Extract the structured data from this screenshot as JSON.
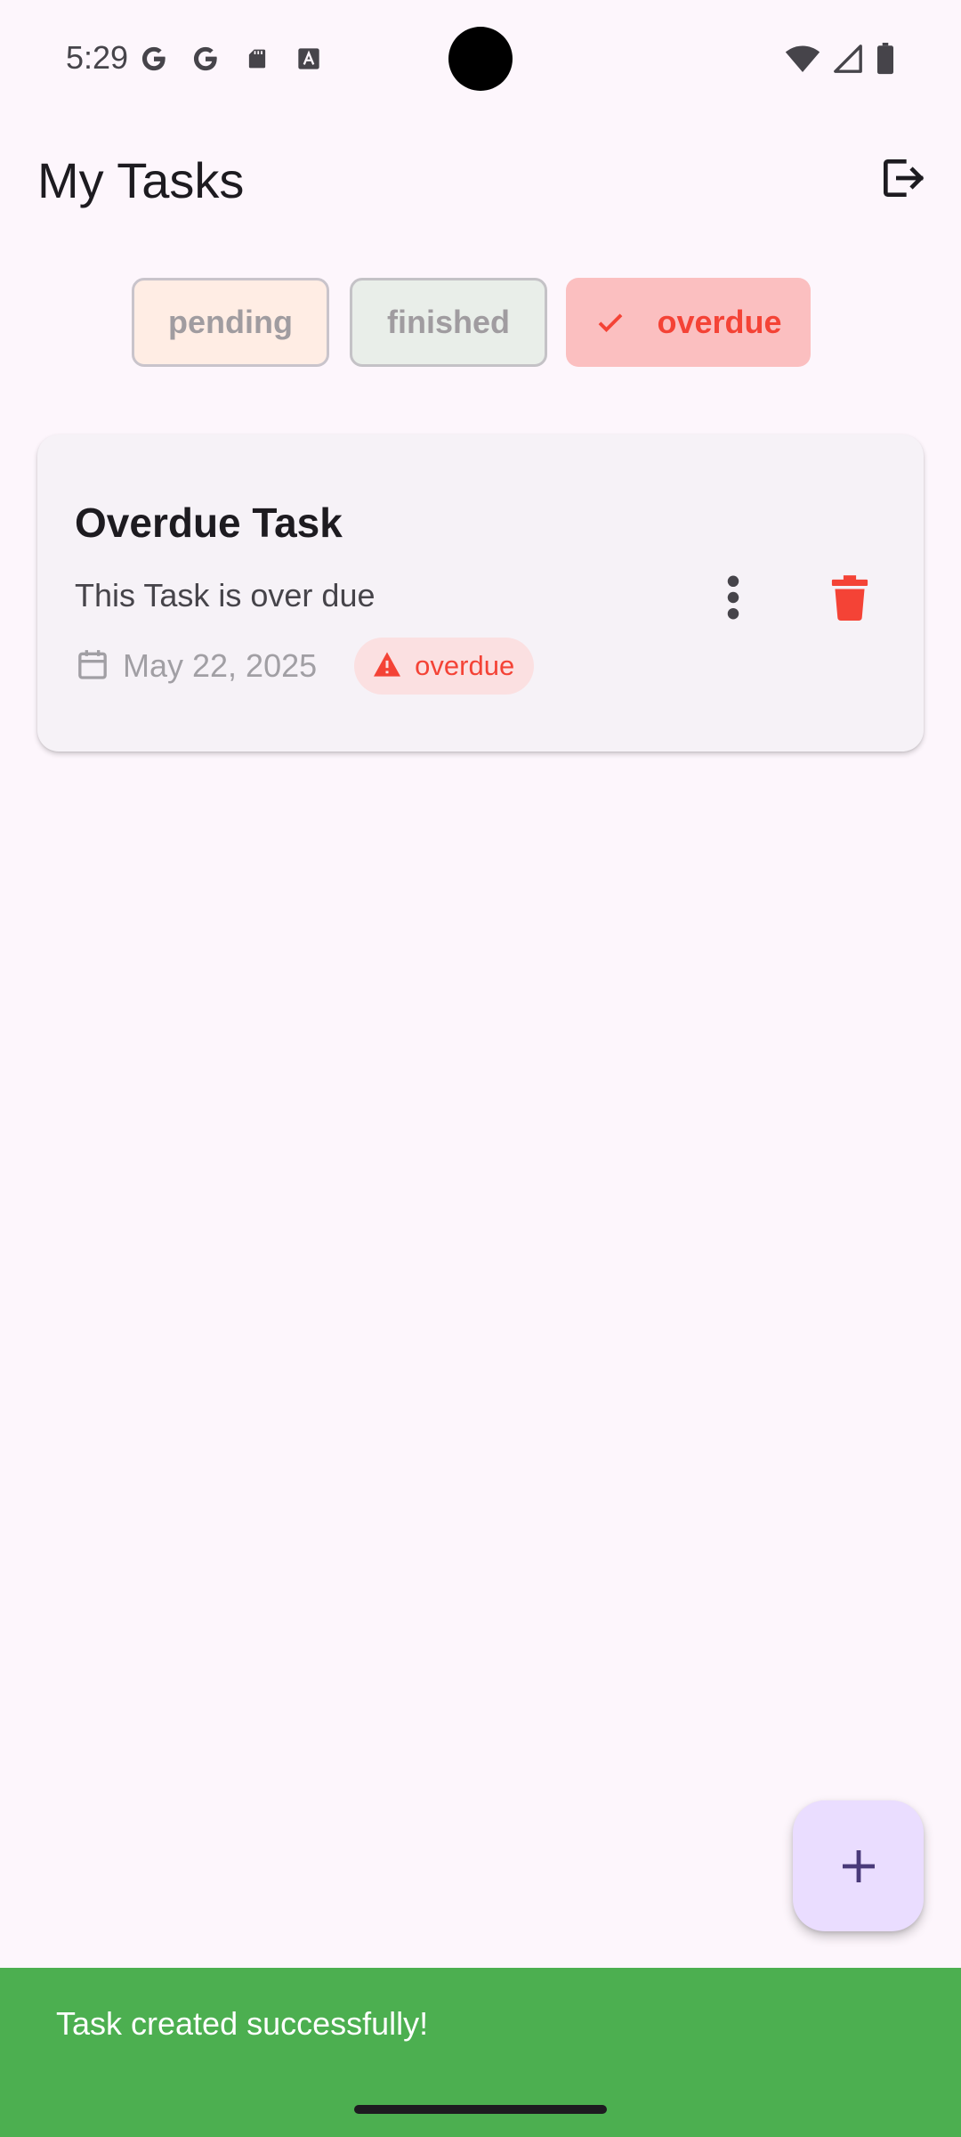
{
  "status_bar": {
    "time": "5:29",
    "left_icons": [
      "google-g-icon",
      "google-g-icon",
      "sd-card-icon",
      "font-a-icon"
    ],
    "right_icons": [
      "wifi-icon",
      "cell-signal-icon",
      "battery-icon"
    ]
  },
  "app_bar": {
    "title": "My Tasks",
    "logout_icon": "logout-icon"
  },
  "filters": [
    {
      "label": "pending",
      "selected": false,
      "color": "#FFEDE4"
    },
    {
      "label": "finished",
      "selected": false,
      "color": "#E9EEE9"
    },
    {
      "label": "overdue",
      "selected": true,
      "color": "#FBBFC0"
    }
  ],
  "tasks": [
    {
      "title": "Overdue Task",
      "description": "This Task is over due",
      "date": "May 22, 2025",
      "status": "overdue",
      "status_color": "#F44336"
    }
  ],
  "fab": {
    "icon": "plus-icon"
  },
  "snackbar": {
    "message": "Task created successfully!",
    "color": "#4CAF50"
  },
  "colors": {
    "background": "#FDF6FC",
    "accent_error": "#F44336",
    "fab": "#EADDFF"
  }
}
